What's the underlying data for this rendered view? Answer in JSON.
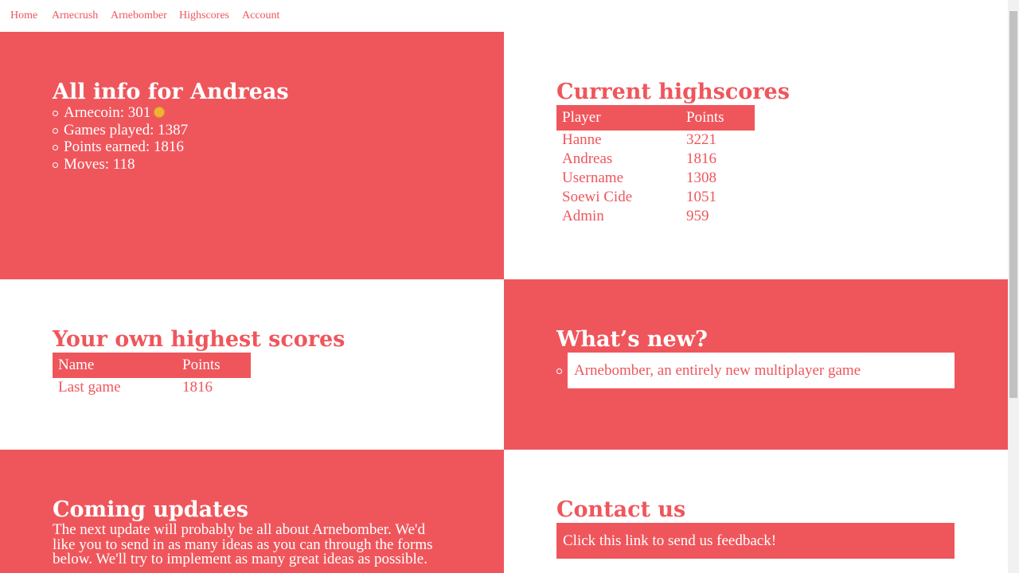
{
  "nav": {
    "items": [
      "Home",
      "Arnecrush",
      "Arnebomber",
      "Highscores",
      "Account"
    ]
  },
  "info": {
    "title": "All info for Andreas",
    "arnecoin": "Arnecoin: 301",
    "games_played": "Games played: 1387",
    "points_earned": "Points earned: 1816",
    "moves": "Moves: 118"
  },
  "highscores": {
    "title": "Current highscores",
    "headers": [
      "Player",
      "Points"
    ],
    "rows": [
      [
        "Hanne",
        "3221"
      ],
      [
        "Andreas",
        "1816"
      ],
      [
        "Username",
        "1308"
      ],
      [
        "Soewi Cide",
        "1051"
      ],
      [
        "Admin",
        "959"
      ]
    ]
  },
  "own_scores": {
    "title": "Your own highest scores",
    "headers": [
      "Name",
      "Points"
    ],
    "rows": [
      [
        "Last game",
        "1816"
      ]
    ]
  },
  "news": {
    "title": "What’s new?",
    "items": [
      "Arnebomber, an entirely new multiplayer game"
    ]
  },
  "updates": {
    "title": "Coming updates",
    "text": "The next update will probably be all about Arnebomber. We'd like you to send in as many ideas as you can through the forms below. We'll try to implement as many great ideas as possible."
  },
  "contact": {
    "title": "Contact us",
    "link_text": "Click this link to send us feedback!"
  },
  "colors": {
    "accent": "#ef565c",
    "coin": "#f2b134"
  },
  "icons": {
    "coin": "coin-icon"
  }
}
